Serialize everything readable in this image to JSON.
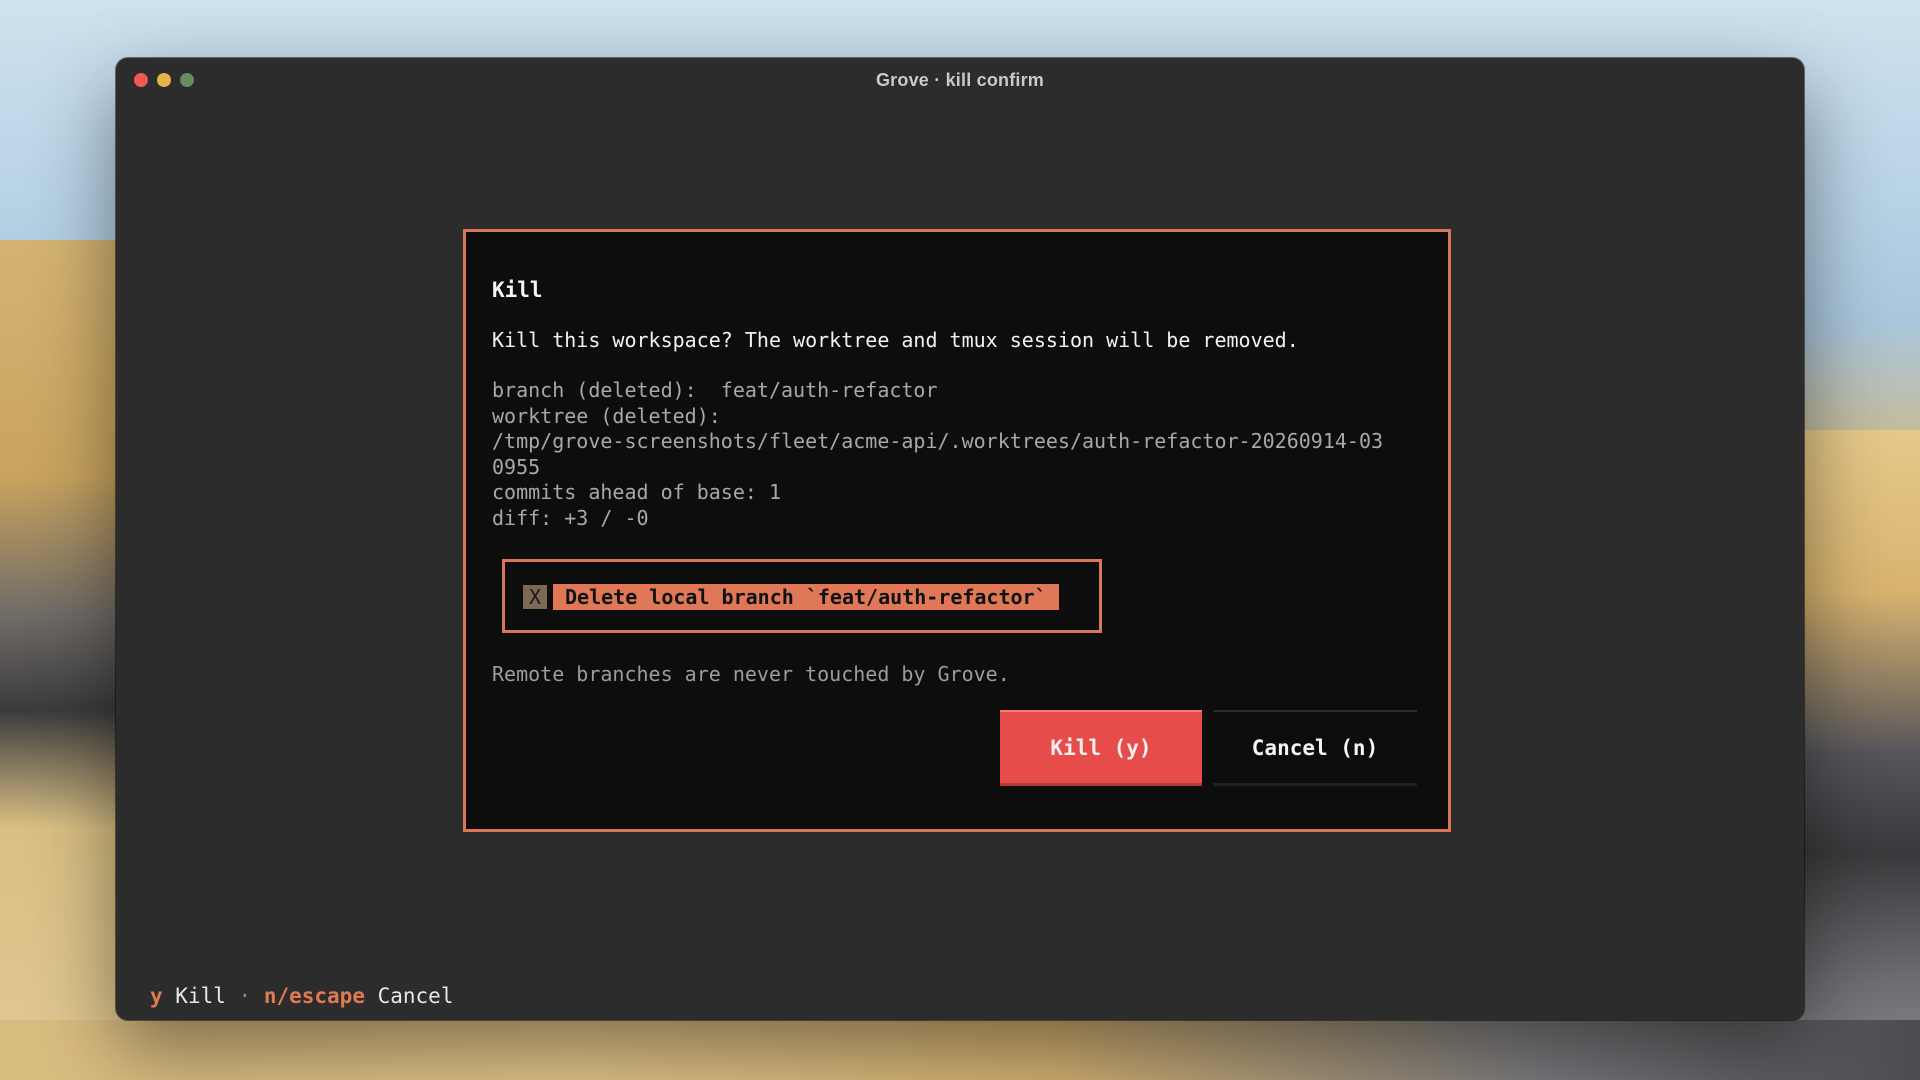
{
  "window": {
    "title": "Grove · kill confirm",
    "traffic_lights": [
      {
        "name": "close",
        "color": "#ee5a52"
      },
      {
        "name": "minimize",
        "color": "#e5b44b"
      },
      {
        "name": "maximize",
        "color": "#6a8c5c"
      }
    ]
  },
  "dialog": {
    "title": "Kill",
    "message": "Kill this workspace? The worktree and tmux session will be removed.",
    "details": {
      "branch": "branch (deleted):  feat/auth-refactor",
      "worktree_label": "worktree (deleted):",
      "worktree_path_line1": "/tmp/grove-screenshots/fleet/acme-api/.worktrees/auth-refactor-20260914-03",
      "worktree_path_line2": "0955",
      "commits": "commits ahead of base: 1",
      "diff": "diff: +3 / -0"
    },
    "checkbox": {
      "mark": "X",
      "label": "Delete local branch `feat/auth-refactor`",
      "checked": true
    },
    "footnote": "Remote branches are never touched by Grove.",
    "buttons": {
      "kill": "Kill (y)",
      "cancel": "Cancel (n)"
    },
    "accent_color": "#d9765a",
    "danger_color": "#e54c4a"
  },
  "statusbar": {
    "key1": "y",
    "label1": " Kill ",
    "sep": "·",
    "key2": " n/escape",
    "label2": " Cancel"
  }
}
